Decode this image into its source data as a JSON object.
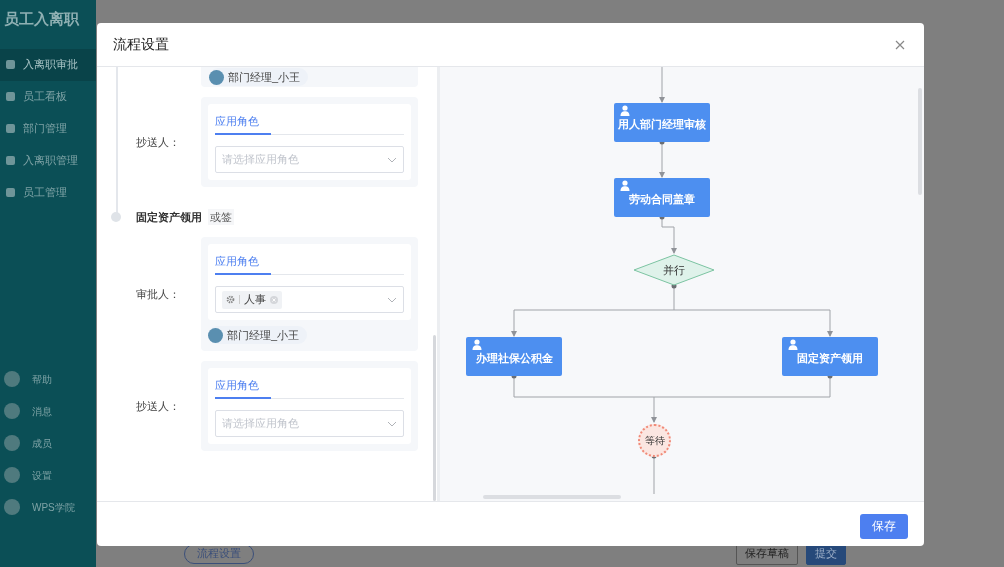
{
  "app": {
    "title": "员工入离职",
    "nav": [
      {
        "label": "入离职审批",
        "selected": true
      },
      {
        "label": "员工看板",
        "selected": false
      },
      {
        "label": "部门管理",
        "selected": false
      },
      {
        "label": "入离职管理",
        "selected": false
      },
      {
        "label": "员工管理",
        "selected": false
      }
    ],
    "bottom_nav": [
      "帮助",
      "消息",
      "成员",
      "设置",
      "WPS学院"
    ],
    "footer_left_button": "流程设置",
    "footer_buttons": [
      {
        "label": "保存草稿",
        "kind": "secondary"
      },
      {
        "label": "提交",
        "kind": "primary"
      }
    ]
  },
  "dialog": {
    "title": "流程设置",
    "blocks": [
      {
        "kind": "members",
        "members": [
          "部门经理_小王"
        ]
      },
      {
        "kind": "role",
        "label": "抄送人：",
        "tabs": [
          {
            "label": "应用角色",
            "selected": true
          }
        ],
        "placeholder": "请选择应用角色"
      },
      {
        "kind": "node",
        "title": "固定资产领用",
        "mode": "或签"
      },
      {
        "kind": "role",
        "label": "审批人：",
        "tabs": [
          {
            "label": "应用角色",
            "selected": true
          }
        ],
        "tags": [
          "人事"
        ],
        "members": [
          "部门经理_小王"
        ]
      },
      {
        "kind": "role",
        "label": "抄送人：",
        "tabs": [
          {
            "label": "应用角色",
            "selected": true
          }
        ],
        "placeholder": "请选择应用角色"
      }
    ],
    "flow": {
      "nodes": [
        {
          "kind": "task",
          "label": "用人部门经理审核"
        },
        {
          "kind": "task",
          "label": "劳动合同盖章"
        },
        {
          "kind": "gateway",
          "label": "并行"
        },
        {
          "kind": "task",
          "label": "办理社保公积金"
        },
        {
          "kind": "task",
          "label": "固定资产领用"
        },
        {
          "kind": "wait",
          "label": "等待"
        }
      ]
    },
    "save_button": "保存"
  }
}
